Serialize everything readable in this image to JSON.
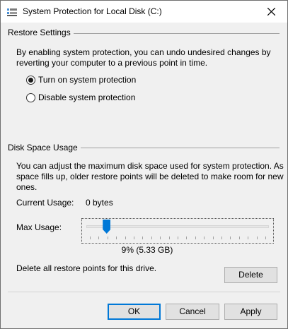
{
  "window": {
    "title": "System Protection for Local Disk (C:)",
    "icon": "system-protection-icon",
    "close_icon": "close-icon"
  },
  "restore_settings": {
    "group_title": "Restore Settings",
    "description_line1": "By enabling system protection, you can undo undesired changes by",
    "description_line2": "reverting your computer to a previous point in time.",
    "options": [
      {
        "label": "Turn on system protection",
        "checked": true
      },
      {
        "label": "Disable system protection",
        "checked": false
      }
    ]
  },
  "disk_space": {
    "group_title": "Disk Space Usage",
    "description_line1": "You can adjust the maximum disk space used for system protection. As",
    "description_line2": "space fills up, older restore points will be deleted to make room for new",
    "description_line3": "ones.",
    "current_usage_label": "Current Usage:",
    "current_usage_value": "0 bytes",
    "max_usage_label": "Max Usage:",
    "max_usage_value": "9% (5.33 GB)",
    "max_usage_percent": 9,
    "delete_text": "Delete all restore points for this drive.",
    "delete_button": "Delete"
  },
  "footer": {
    "ok": "OK",
    "cancel": "Cancel",
    "apply": "Apply"
  },
  "colors": {
    "accent": "#0078d7",
    "background": "#f0f0f0"
  }
}
